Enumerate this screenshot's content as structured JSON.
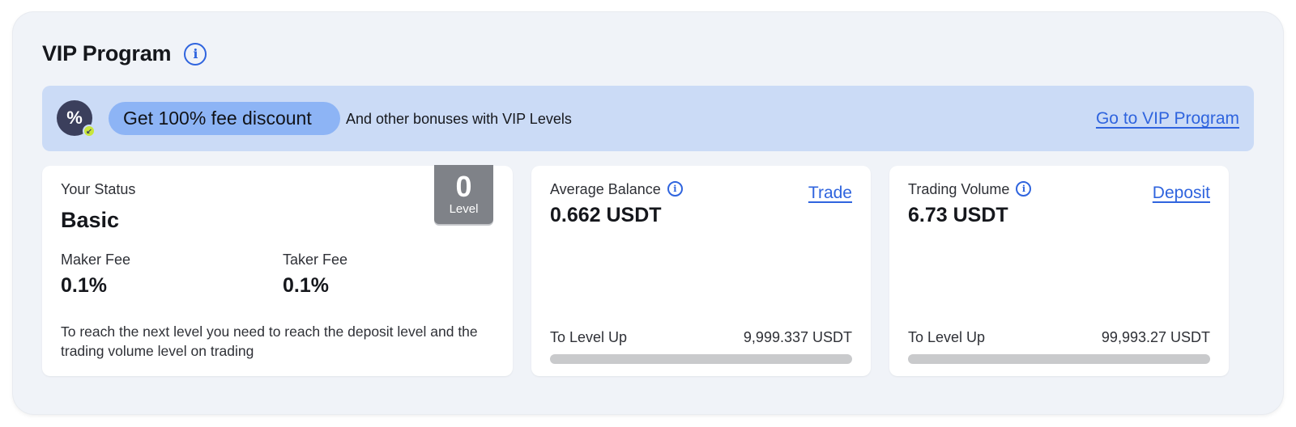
{
  "header": {
    "title": "VIP Program",
    "info_icon": "info-icon"
  },
  "banner": {
    "icon": "percent-badge-icon",
    "pill_text": "Get 100% fee discount",
    "subtitle": "And other bonuses with VIP Levels",
    "link": "Go to VIP Program"
  },
  "status_card": {
    "label": "Your Status",
    "status": "Basic",
    "level_value": "0",
    "level_label": "Level",
    "maker_fee_label": "Maker Fee",
    "maker_fee_value": "0.1%",
    "taker_fee_label": "Taker Fee",
    "taker_fee_value": "0.1%",
    "note": "To reach the next level you need to reach the deposit level and the trading volume level on trading"
  },
  "balance_card": {
    "label": "Average Balance",
    "value": "0.662 USDT",
    "action": "Trade",
    "level_up_label": "To Level Up",
    "level_up_value": "9,999.337 USDT",
    "progress": 0.0
  },
  "volume_card": {
    "label": "Trading Volume",
    "value": "6.73 USDT",
    "action": "Deposit",
    "level_up_label": "To Level Up",
    "level_up_value": "99,993.27 USDT",
    "progress": 0.0
  },
  "colors": {
    "accent": "#2f64de",
    "banner_bg": "#cbdbf6",
    "pill_bg": "#8db4f5",
    "panel_bg": "#f0f3f8"
  }
}
